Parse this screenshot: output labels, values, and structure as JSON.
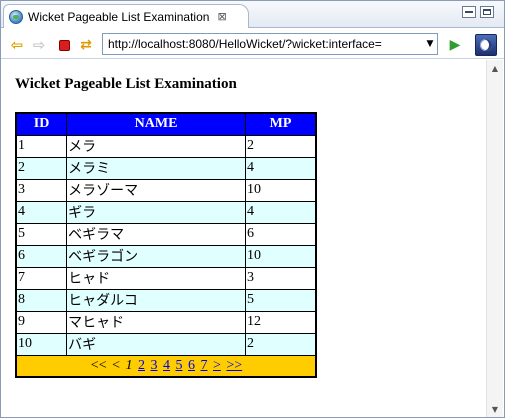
{
  "window": {
    "tab_title": "Wicket Pageable List Examination",
    "tab_close": "⊠"
  },
  "toolbar": {
    "url": "http://localhost:8080/HelloWicket/?wicket:interface="
  },
  "page": {
    "title": "Wicket Pageable List Examination"
  },
  "table": {
    "columns": [
      "ID",
      "NAME",
      "MP"
    ],
    "rows": [
      {
        "id": "1",
        "name": "メラ",
        "mp": "2"
      },
      {
        "id": "2",
        "name": "メラミ",
        "mp": "4"
      },
      {
        "id": "3",
        "name": "メラゾーマ",
        "mp": "10"
      },
      {
        "id": "4",
        "name": "ギラ",
        "mp": "4"
      },
      {
        "id": "5",
        "name": "ベギラマ",
        "mp": "6"
      },
      {
        "id": "6",
        "name": "ベギラゴン",
        "mp": "10"
      },
      {
        "id": "7",
        "name": "ヒャド",
        "mp": "3"
      },
      {
        "id": "8",
        "name": "ヒャダルコ",
        "mp": "5"
      },
      {
        "id": "9",
        "name": "マヒャド",
        "mp": "12"
      },
      {
        "id": "10",
        "name": "バギ",
        "mp": "2"
      }
    ],
    "pager": {
      "first": "<<",
      "prev": "<",
      "current": "1",
      "pages": [
        "2",
        "3",
        "4",
        "5",
        "6",
        "7"
      ],
      "next": ">",
      "last": ">>"
    }
  },
  "icons": {
    "back": "back-arrow-icon",
    "forward": "forward-arrow-icon",
    "stop": "stop-icon",
    "refresh": "refresh-icon",
    "go": "go-arrow-icon",
    "eclipse": "eclipse-icon"
  },
  "colors": {
    "header_bg": "#0000ff",
    "row_alt_bg": "#e0ffff",
    "pager_bg": "#ffcc00",
    "link": "#0000ee"
  }
}
